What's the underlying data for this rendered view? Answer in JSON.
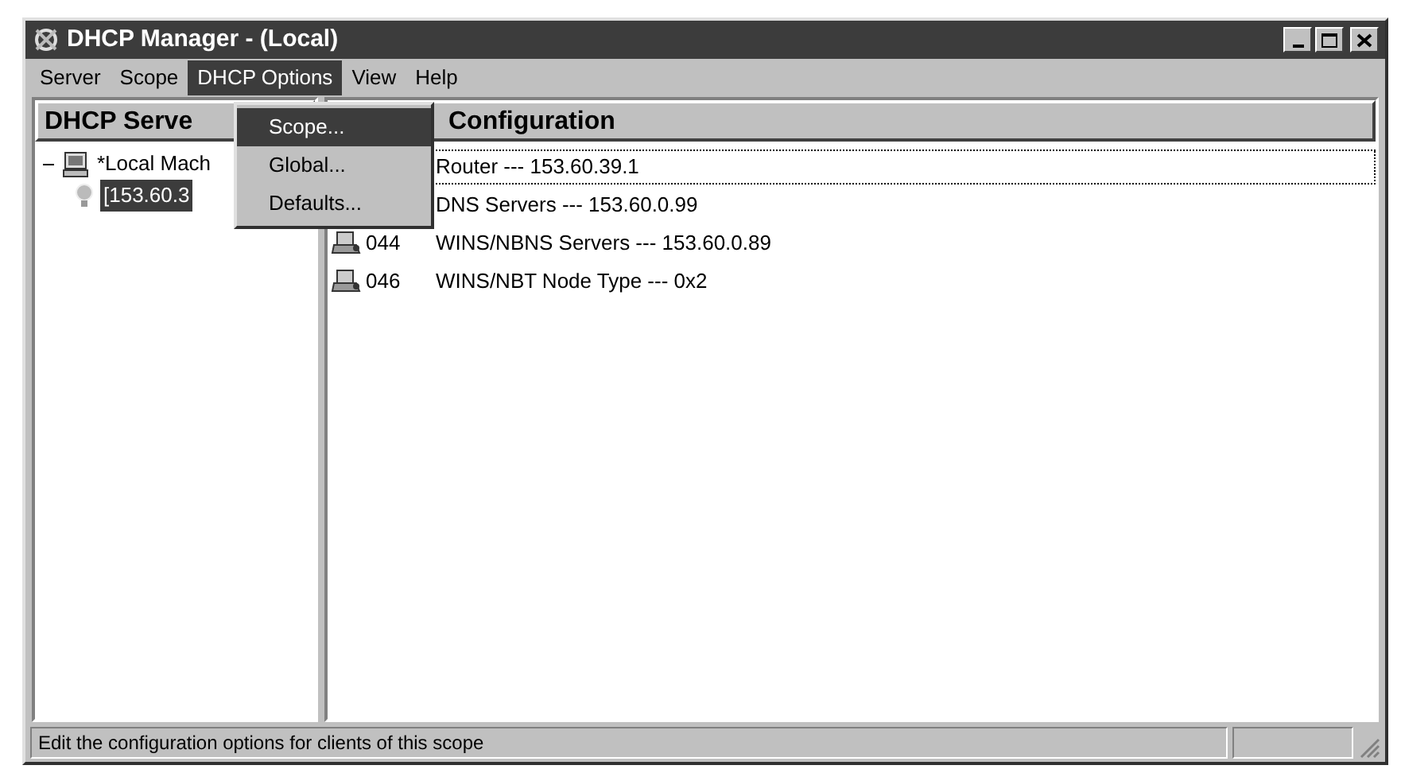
{
  "window": {
    "title": "DHCP Manager - (Local)"
  },
  "menu_bar": [
    {
      "label": "Server",
      "selected": false
    },
    {
      "label": "Scope",
      "selected": false
    },
    {
      "label": "DHCP Options",
      "selected": true
    },
    {
      "label": "View",
      "selected": false
    },
    {
      "label": "Help",
      "selected": false
    }
  ],
  "dropdown": [
    {
      "label": "Scope...",
      "selected": true
    },
    {
      "label": "Global...",
      "selected": false
    },
    {
      "label": "Defaults...",
      "selected": false
    }
  ],
  "left_pane": {
    "header": "DHCP Serve",
    "tree": [
      {
        "label": "*Local Mach",
        "selected": false,
        "expanded": true,
        "children": [
          {
            "label": "[153.60.3",
            "selected": true
          }
        ]
      }
    ]
  },
  "right_pane": {
    "header": "Configuration",
    "rows": [
      {
        "code": "",
        "text": "Router --- 153.60.39.1",
        "focused": true
      },
      {
        "code": "",
        "text": "DNS Servers --- 153.60.0.99",
        "focused": false
      },
      {
        "code": "044",
        "text": "WINS/NBNS Servers --- 153.60.0.89",
        "focused": false
      },
      {
        "code": "046",
        "text": "WINS/NBT Node Type --- 0x2",
        "focused": false
      }
    ]
  },
  "status_bar": {
    "text": "Edit the configuration options for clients of this scope"
  }
}
